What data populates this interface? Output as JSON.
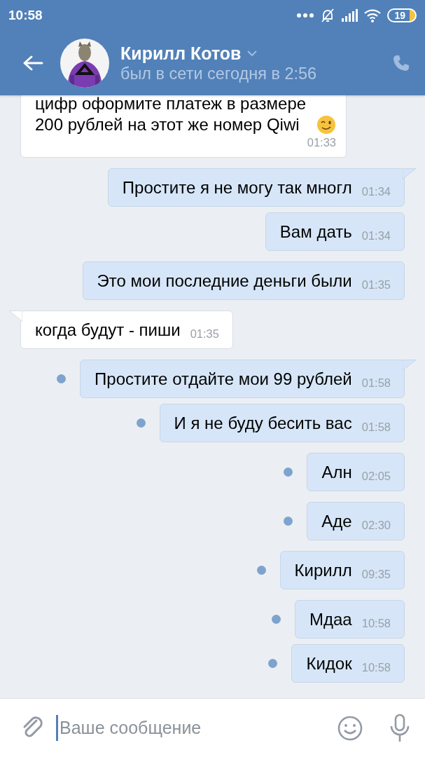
{
  "status_bar": {
    "time": "10:58",
    "battery": "19"
  },
  "header": {
    "name": "Кирилл Котов",
    "status": "был в сети сегодня в 2:56"
  },
  "messages": [
    {
      "outgoing": false,
      "text": "цифр оформите платеж в размере 200 рублей на этот же номер Qiwi",
      "has_emoji": true,
      "time": "01:33",
      "unread": false
    },
    {
      "outgoing": true,
      "text": "Простите я не могу так многл",
      "time": "01:34",
      "unread": false,
      "tail": true
    },
    {
      "outgoing": true,
      "text": "Вам дать",
      "time": "01:34",
      "unread": false,
      "tail": false
    },
    {
      "outgoing": true,
      "text": "Это мои последние деньги были",
      "time": "01:35",
      "unread": false,
      "tail": false
    },
    {
      "outgoing": false,
      "text": "когда будут - пиши",
      "time": "01:35",
      "unread": false,
      "tail": true
    },
    {
      "outgoing": true,
      "text": "Простите отдайте мои 99 рублей",
      "time": "01:58",
      "unread": true,
      "tail": true
    },
    {
      "outgoing": true,
      "text": "И я не буду бесить вас",
      "time": "01:58",
      "unread": true,
      "tail": false
    },
    {
      "outgoing": true,
      "text": "Алн",
      "time": "02:05",
      "unread": true,
      "tail": false
    },
    {
      "outgoing": true,
      "text": "Аде",
      "time": "02:30",
      "unread": true,
      "tail": false
    },
    {
      "outgoing": true,
      "text": "Кирилл",
      "time": "09:35",
      "unread": true,
      "tail": false
    },
    {
      "outgoing": true,
      "text": "Мдаа",
      "time": "10:58",
      "unread": true,
      "tail": false
    },
    {
      "outgoing": true,
      "text": "Кидок",
      "time": "10:58",
      "unread": true,
      "tail": false
    }
  ],
  "composer": {
    "placeholder": "Ваше сообщение"
  }
}
